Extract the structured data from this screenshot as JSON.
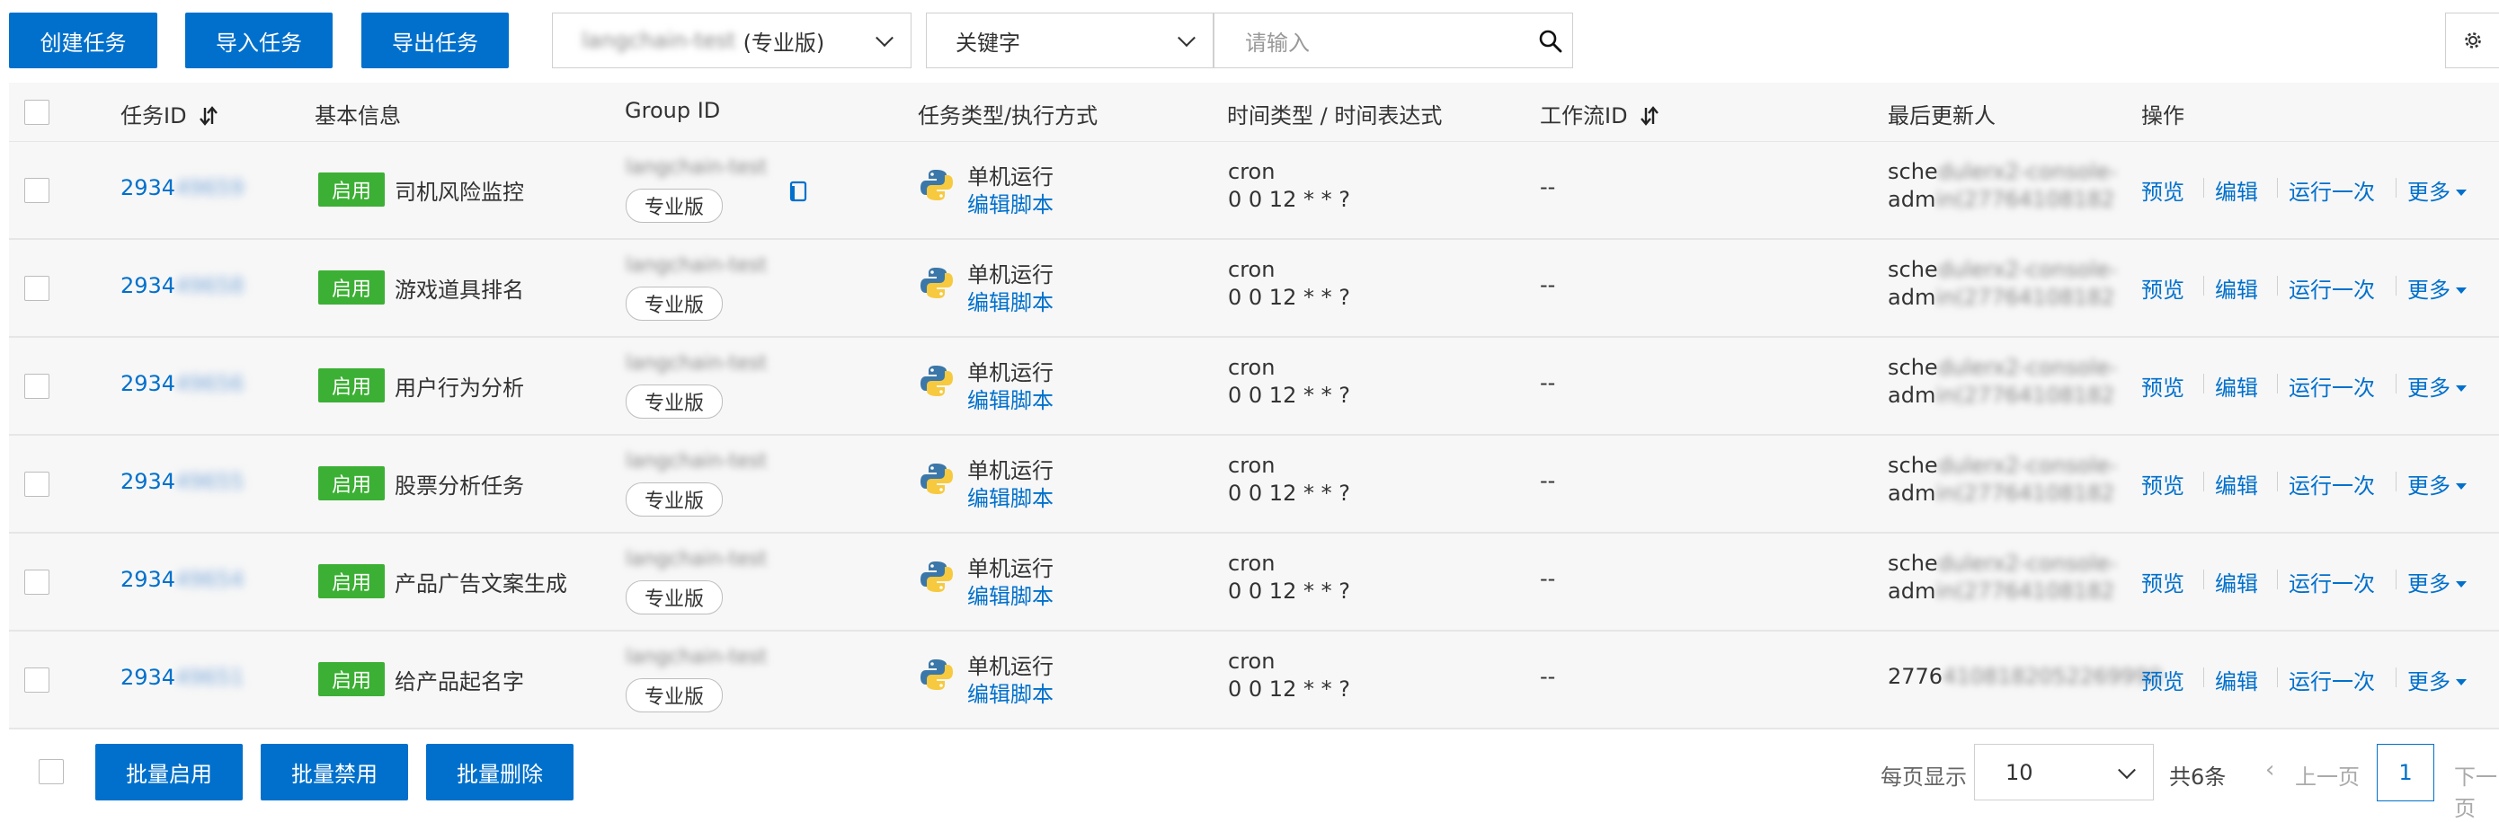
{
  "toolbar": {
    "create_label": "创建任务",
    "import_label": "导入任务",
    "export_label": "导出任务",
    "group_select": {
      "value_blurred": "langchain-test",
      "value_suffix": "(专业版)"
    },
    "keyword_select": "关键字",
    "search_placeholder": "请输入",
    "icons": {
      "search": "search-icon",
      "settings": "gear-icon",
      "caret": "chevron-down-icon"
    }
  },
  "table": {
    "columns": [
      "任务ID",
      "基本信息",
      "Group ID",
      "任务类型/执行方式",
      "时间类型 / 时间表达式",
      "工作流ID",
      "最后更新人",
      "操作"
    ],
    "rows": [
      {
        "id_prefix": "2934",
        "id_suffix": "49659",
        "status": "启用",
        "name": "司机风险监控",
        "group_blur": "langchain-test",
        "group_tag": "专业版",
        "has_copy": true,
        "run_mode": "单机运行",
        "edit_script": "编辑脚本",
        "time_type": "cron",
        "time_expr": "0 0 12 * * ?",
        "workflow": "--",
        "updater_line1": "sche",
        "updater_line1_blur": "dulerx2-console-",
        "updater_line2": "adm",
        "updater_line2_blur": "in(27764108182",
        "actions": [
          "预览",
          "编辑",
          "运行一次",
          "更多"
        ]
      },
      {
        "id_prefix": "2934",
        "id_suffix": "49658",
        "status": "启用",
        "name": "游戏道具排名",
        "group_blur": "langchain-test",
        "group_tag": "专业版",
        "has_copy": false,
        "run_mode": "单机运行",
        "edit_script": "编辑脚本",
        "time_type": "cron",
        "time_expr": "0 0 12 * * ?",
        "workflow": "--",
        "updater_line1": "sche",
        "updater_line1_blur": "dulerx2-console-",
        "updater_line2": "adm",
        "updater_line2_blur": "in(27764108182",
        "actions": [
          "预览",
          "编辑",
          "运行一次",
          "更多"
        ]
      },
      {
        "id_prefix": "2934",
        "id_suffix": "49656",
        "status": "启用",
        "name": "用户行为分析",
        "group_blur": "langchain-test",
        "group_tag": "专业版",
        "has_copy": false,
        "run_mode": "单机运行",
        "edit_script": "编辑脚本",
        "time_type": "cron",
        "time_expr": "0 0 12 * * ?",
        "workflow": "--",
        "updater_line1": "sche",
        "updater_line1_blur": "dulerx2-console-",
        "updater_line2": "adm",
        "updater_line2_blur": "in(27764108182",
        "actions": [
          "预览",
          "编辑",
          "运行一次",
          "更多"
        ]
      },
      {
        "id_prefix": "2934",
        "id_suffix": "49655",
        "status": "启用",
        "name": "股票分析任务",
        "group_blur": "langchain-test",
        "group_tag": "专业版",
        "has_copy": false,
        "run_mode": "单机运行",
        "edit_script": "编辑脚本",
        "time_type": "cron",
        "time_expr": "0 0 12 * * ?",
        "workflow": "--",
        "updater_line1": "sche",
        "updater_line1_blur": "dulerx2-console-",
        "updater_line2": "adm",
        "updater_line2_blur": "in(27764108182",
        "actions": [
          "预览",
          "编辑",
          "运行一次",
          "更多"
        ]
      },
      {
        "id_prefix": "2934",
        "id_suffix": "49654",
        "status": "启用",
        "name": "产品广告文案生成",
        "group_blur": "langchain-test",
        "group_tag": "专业版",
        "has_copy": false,
        "run_mode": "单机运行",
        "edit_script": "编辑脚本",
        "time_type": "cron",
        "time_expr": "0 0 12 * * ?",
        "workflow": "--",
        "updater_line1": "sche",
        "updater_line1_blur": "dulerx2-console-",
        "updater_line2": "adm",
        "updater_line2_blur": "in(27764108182",
        "actions": [
          "预览",
          "编辑",
          "运行一次",
          "更多"
        ]
      },
      {
        "id_prefix": "2934",
        "id_suffix": "49651",
        "status": "启用",
        "name": "给产品起名字",
        "group_blur": "langchain-test",
        "group_tag": "专业版",
        "has_copy": false,
        "run_mode": "单机运行",
        "edit_script": "编辑脚本",
        "time_type": "cron",
        "time_expr": "0 0 12 * * ?",
        "workflow": "--",
        "updater_line1": "2776",
        "updater_line1_blur": "4108182052269990",
        "updater_line2": "",
        "updater_line2_blur": "",
        "actions": [
          "预览",
          "编辑",
          "运行一次",
          "更多"
        ]
      }
    ]
  },
  "bottom": {
    "batch_enable": "批量启用",
    "batch_disable": "批量禁用",
    "batch_delete": "批量删除",
    "per_page_label": "每页显示",
    "per_page_value": "10",
    "total": "共6条",
    "prev": "上一页",
    "current_page": "1",
    "next": "下一页"
  },
  "colors": {
    "primary": "#0070cc",
    "enabled_badge": "#3cb034",
    "row_bg": "#f7f7f7"
  }
}
